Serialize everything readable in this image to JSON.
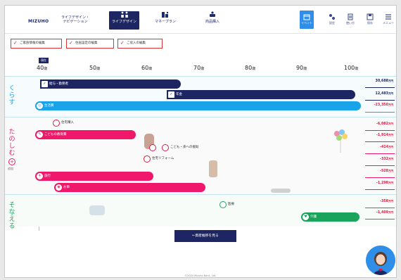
{
  "header": {
    "logo": "MIZUHO",
    "nav": [
      {
        "label_1": "ライフデザイン・",
        "label_2": "ナビゲーション"
      },
      {
        "label_1": "ライフデザイン",
        "label_2": ""
      },
      {
        "label_1": "マネープラン",
        "label_2": ""
      },
      {
        "label_1": "商品購入",
        "label_2": ""
      }
    ],
    "right_nav": [
      {
        "label": "イベント"
      },
      {
        "label": "設定"
      },
      {
        "label": "使い方"
      },
      {
        "label": "保存"
      },
      {
        "label": "メニュー"
      }
    ]
  },
  "filters": [
    {
      "label": "ご家族情報の編集"
    },
    {
      "label": "住居設定の編集"
    },
    {
      "label": "ご収入の編集"
    }
  ],
  "age_badge": "現在",
  "ages": [
    {
      "num": "40",
      "unit": "歳"
    },
    {
      "num": "50",
      "unit": "歳"
    },
    {
      "num": "60",
      "unit": "歳"
    },
    {
      "num": "70",
      "unit": "歳"
    },
    {
      "num": "80",
      "unit": "歳"
    },
    {
      "num": "90",
      "unit": "歳"
    },
    {
      "num": "100",
      "unit": "歳"
    }
  ],
  "sections": {
    "kurasu": "くらす",
    "tanoshimu": "たのしむ",
    "tanoshimu_sub": "追加",
    "sonaeru": "そなえる"
  },
  "bars": {
    "salary": "給与・勤務者",
    "pension": "年金",
    "living": "生活費",
    "education": "こどもの教育費",
    "travel": "旅行",
    "car": "お車"
  },
  "pins": {
    "housing": "住宅購入",
    "child_gift": "こども・孫への援助",
    "reform": "住宅リフォーム",
    "medical": "医療",
    "care": "介護"
  },
  "amounts": [
    {
      "value": "30,688",
      "unit": "万円",
      "color": "#1d2663"
    },
    {
      "value": "12,483",
      "unit": "万円",
      "color": "#1d2663"
    },
    {
      "value": "-23,350",
      "unit": "万円",
      "color": "#e0173f"
    },
    {
      "value": "-6,082",
      "unit": "万円",
      "color": "#e0173f"
    },
    {
      "value": "-1,914",
      "unit": "万円",
      "color": "#e0173f"
    },
    {
      "value": "-414",
      "unit": "万円",
      "color": "#e0173f"
    },
    {
      "value": "-332",
      "unit": "万円",
      "color": "#e0173f"
    },
    {
      "value": "-528",
      "unit": "万円",
      "color": "#e0173f"
    },
    {
      "value": "-1,298",
      "unit": "万円",
      "color": "#e0173f"
    },
    {
      "value": "-358",
      "unit": "万円",
      "color": "#e0173f"
    },
    {
      "value": "-1,409",
      "unit": "万円",
      "color": "#e0173f"
    }
  ],
  "cta": "←資産推移を見る",
  "copyright": "©2020 Mizuho Bank, Ltd.",
  "colors": {
    "navy": "#1d2663",
    "blue": "#1aa3e8",
    "pink": "#f0186a",
    "green": "#19a35b",
    "active_blue": "#2e8ee8"
  }
}
